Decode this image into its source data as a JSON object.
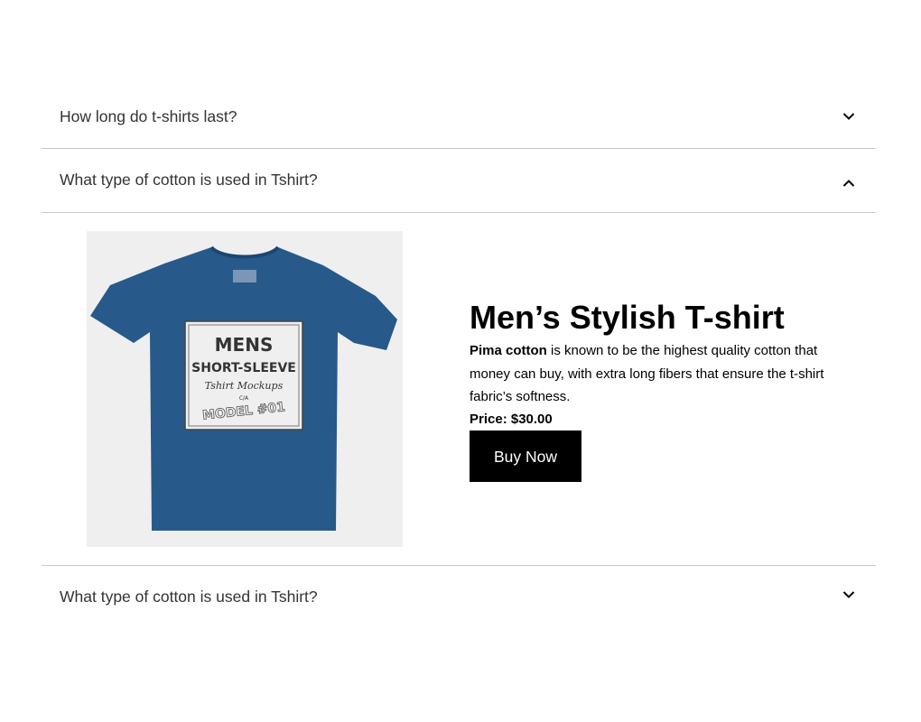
{
  "faq": {
    "items": [
      {
        "question": "How long do t-shirts last?",
        "expanded": false,
        "icon": "chevron-down-icon"
      },
      {
        "question": "What type of cotton is used in Tshirt?",
        "expanded": true,
        "icon": "chevron-up-icon"
      },
      {
        "question": "What type of cotton is used in Tshirt?",
        "expanded": false,
        "icon": "chevron-down-icon"
      }
    ]
  },
  "product": {
    "title": "Men’s Stylish T-shirt",
    "desc_bold": "Pima cotton",
    "desc_rest": " is known to be the highest quality cotton that money can buy, with extra long fibers that ensure the t-shirt fabric’s softness.",
    "price_label": "Price: $30.00",
    "buy_label": "Buy Now",
    "shirt_color": "#27598a",
    "graphic": {
      "line1": "MENS",
      "line2": "SHORT-SLEEVE",
      "line3": "Tshirt Mockups",
      "line4": "C/A",
      "line5": "MODEL #01"
    }
  }
}
